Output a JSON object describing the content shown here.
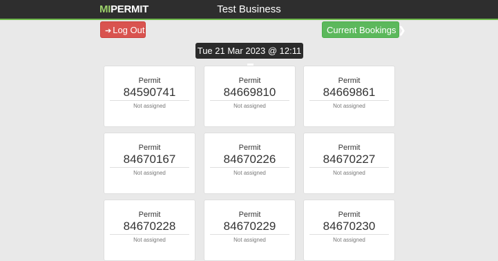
{
  "header": {
    "logo_mi": "MI",
    "logo_permit": "PERMIT",
    "business_name": "Test Business"
  },
  "actions": {
    "logout_label": "Log Out",
    "bookings_label": "Current Bookings"
  },
  "date_display": "Tue 21 Mar 2023 @ 12:11",
  "permits": [
    {
      "label": "Permit",
      "number": "84590741",
      "status": "Not assigned"
    },
    {
      "label": "Permit",
      "number": "84669810",
      "status": "Not assigned"
    },
    {
      "label": "Permit",
      "number": "84669861",
      "status": "Not assigned"
    },
    {
      "label": "Permit",
      "number": "84670167",
      "status": "Not assigned"
    },
    {
      "label": "Permit",
      "number": "84670226",
      "status": "Not assigned"
    },
    {
      "label": "Permit",
      "number": "84670227",
      "status": "Not assigned"
    },
    {
      "label": "Permit",
      "number": "84670228",
      "status": "Not assigned"
    },
    {
      "label": "Permit",
      "number": "84670229",
      "status": "Not assigned"
    },
    {
      "label": "Permit",
      "number": "84670230",
      "status": "Not assigned"
    }
  ],
  "colors": {
    "topbar": "#2e2e2e",
    "accent_green": "#6eb84a",
    "logout_red": "#d9534f",
    "bookings_green": "#5cb85c"
  }
}
